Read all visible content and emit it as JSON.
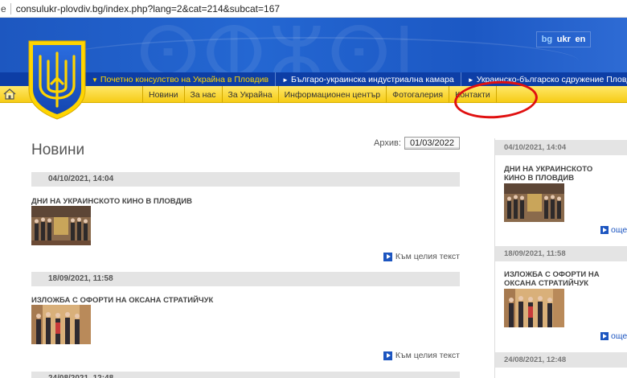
{
  "address_bar": {
    "prefix": "e",
    "url": "consulukr-plovdiv.bg/index.php?lang=2&cat=214&subcat=167"
  },
  "languages": [
    {
      "label": "bg",
      "active": true
    },
    {
      "label": "ukr",
      "active": false
    },
    {
      "label": "en",
      "active": false
    }
  ],
  "top_links": [
    {
      "label": "Почетно консулство на Украйна в Пловдив",
      "active": true
    },
    {
      "label": "Българо-украинска индустриална камара",
      "active": false
    },
    {
      "label": "Украинско-българско сдружение Пловдив",
      "active": false
    }
  ],
  "menu": [
    "Новини",
    "За нас",
    "За Украйна",
    "Информационен център",
    "Фотогалерия",
    "Контакти"
  ],
  "main": {
    "title": "Новини",
    "archive_label": "Архив:",
    "archive_date": "01/03/2022",
    "read_more": "Към целия текст",
    "news": [
      {
        "date": "04/10/2021, 14:04",
        "title": "ДНИ НА УКРАИНСКОТО КИНО В ПЛОВДИВ"
      },
      {
        "date": "18/09/2021, 11:58",
        "title": "ИЗЛОЖБА С ОФОРТИ НА ОКСАНА СТРАТИЙЧУК"
      },
      {
        "date": "24/08/2021, 12:48",
        "title": ""
      }
    ]
  },
  "sidebar": {
    "more": "още",
    "news": [
      {
        "date": "04/10/2021, 14:04",
        "title": "ДНИ НА УКРАИНСКОТО КИНО В ПЛОВДИВ"
      },
      {
        "date": "18/09/2021, 11:58",
        "title": "ИЗЛОЖБА С ОФОРТИ НА ОКСАНА СТРАТИЙЧУК"
      },
      {
        "date": "24/08/2021, 12:48",
        "title": ""
      }
    ]
  },
  "colors": {
    "banner_blue": "#2467d2",
    "strip_blue": "#0d3ea6",
    "menu_yellow": "#f6cc16",
    "active_link": "#ffd600",
    "annotation_red": "#e01010"
  }
}
